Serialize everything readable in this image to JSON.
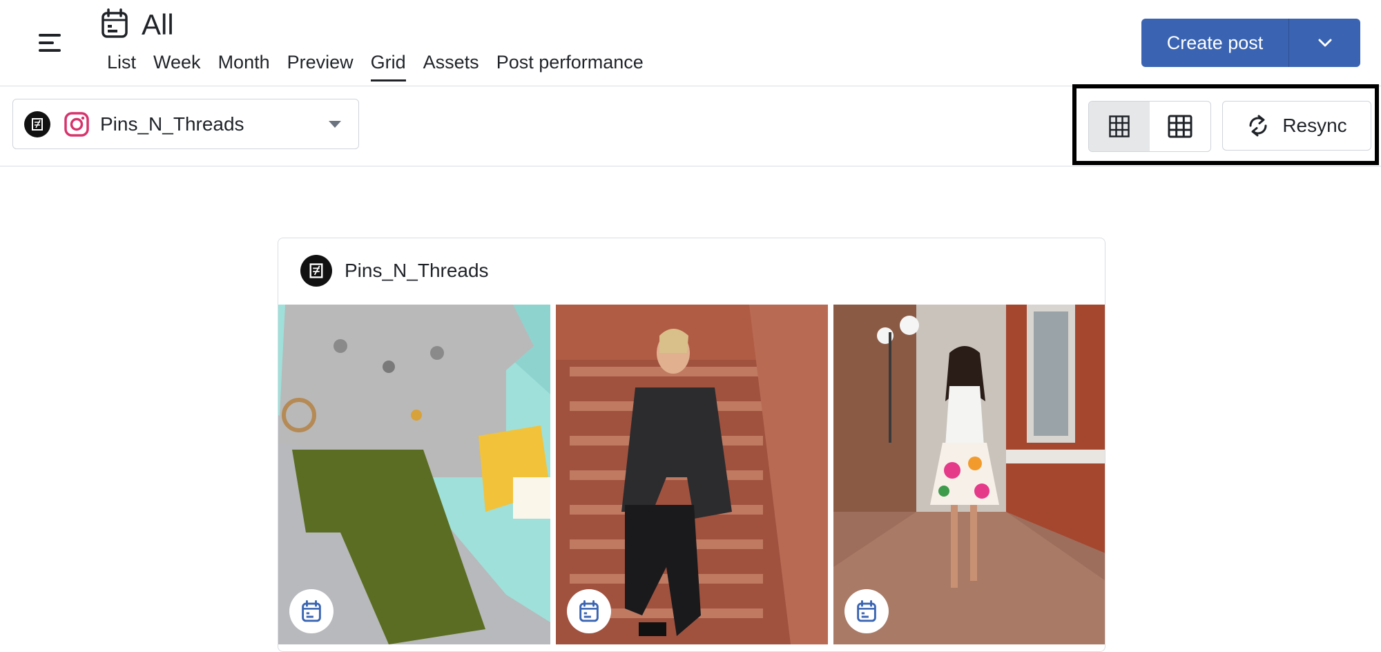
{
  "header": {
    "title": "All",
    "tabs": [
      {
        "label": "List",
        "active": false
      },
      {
        "label": "Week",
        "active": false
      },
      {
        "label": "Month",
        "active": false
      },
      {
        "label": "Preview",
        "active": false
      },
      {
        "label": "Grid",
        "active": true
      },
      {
        "label": "Assets",
        "active": false
      },
      {
        "label": "Post performance",
        "active": false
      }
    ],
    "create_post_label": "Create post",
    "icons": {
      "menu": "hamburger-menu-icon",
      "calendar": "calendar-icon",
      "caret": "chevron-down-icon"
    }
  },
  "toolbar": {
    "account": {
      "name": "Pins_N_Threads",
      "network": "instagram"
    },
    "view_options": [
      "grid-3x3-small",
      "grid-3x3-large"
    ],
    "selected_view": 0,
    "resync_label": "Resync"
  },
  "card": {
    "account_name": "Pins_N_Threads",
    "posts": [
      {
        "description": "flat-lay t-shirt and green shorts",
        "badge_icon": "calendar-icon"
      },
      {
        "description": "woman sitting on brick stairs",
        "badge_icon": "calendar-icon"
      },
      {
        "description": "woman walking on sidewalk in floral skirt",
        "badge_icon": "calendar-icon"
      }
    ]
  },
  "colors": {
    "primary": "#3a64b2",
    "text": "#1f2328",
    "border": "#d9dde2",
    "instagram": "#d6336c"
  }
}
